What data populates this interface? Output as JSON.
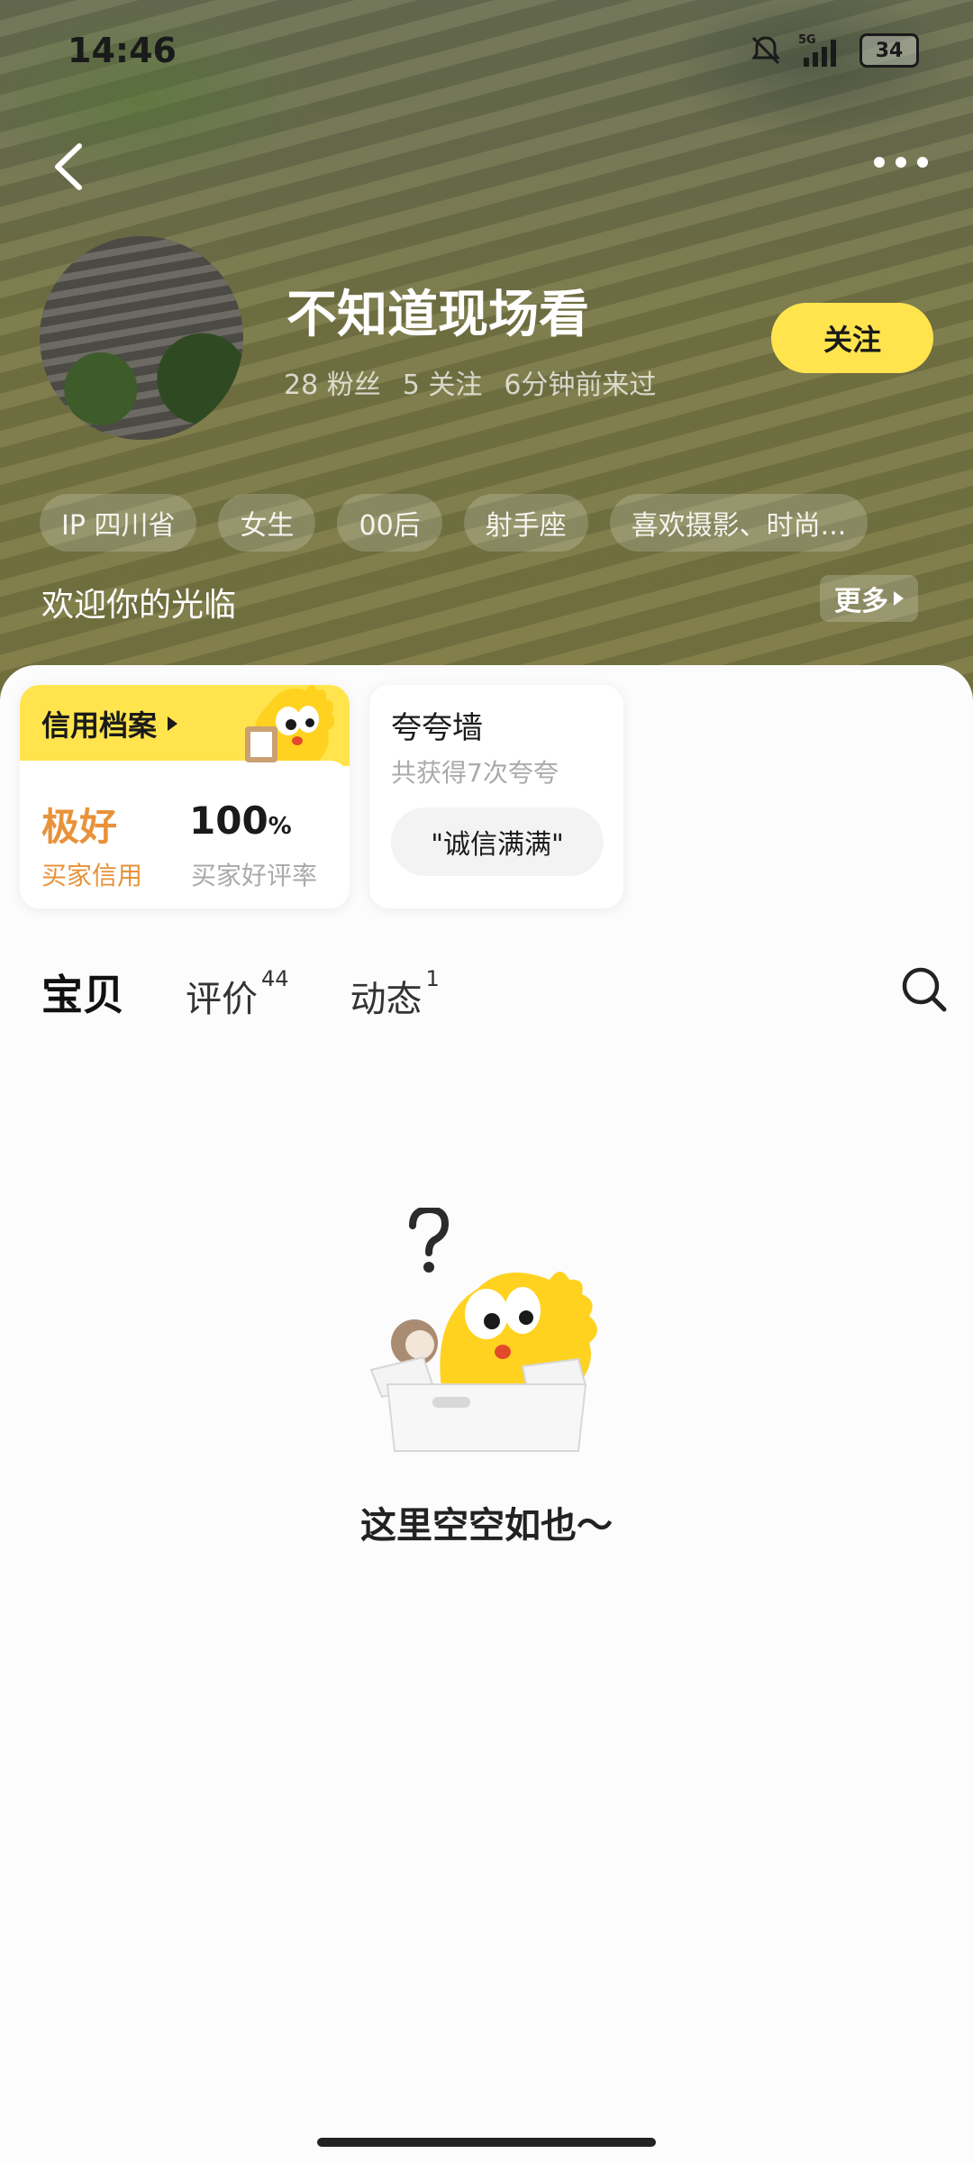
{
  "status_bar": {
    "time": "14:46",
    "network": "5G",
    "battery": "34"
  },
  "profile": {
    "nickname": "不知道现场看",
    "fans": "28 粉丝",
    "following": "5 关注",
    "last_seen": "6分钟前来过",
    "follow_label": "关注",
    "tags": [
      "IP 四川省",
      "女生",
      "00后",
      "射手座",
      "喜欢摄影、时尚..."
    ],
    "welcome": "欢迎你的光临",
    "more_label": "更多"
  },
  "credit": {
    "title": "信用档案",
    "level": "极好",
    "level_label": "买家信用",
    "rate": "100",
    "rate_unit": "%",
    "rate_label": "买家好评率"
  },
  "praise": {
    "title": "夸夸墙",
    "subtitle": "共获得7次夸夸",
    "chip": "\"诚信满满\""
  },
  "tabs": [
    {
      "label": "宝贝",
      "count": ""
    },
    {
      "label": "评价",
      "count": "44"
    },
    {
      "label": "动态",
      "count": "1"
    }
  ],
  "empty_state": {
    "text": "这里空空如也～"
  },
  "colors": {
    "accent": "#ffe44d",
    "credit_orange": "#e8923a",
    "header_olive": "#7c7b47"
  },
  "icons": [
    "back-icon",
    "more-dots-icon",
    "search-icon",
    "mute-icon",
    "signal-icon",
    "battery-icon"
  ]
}
